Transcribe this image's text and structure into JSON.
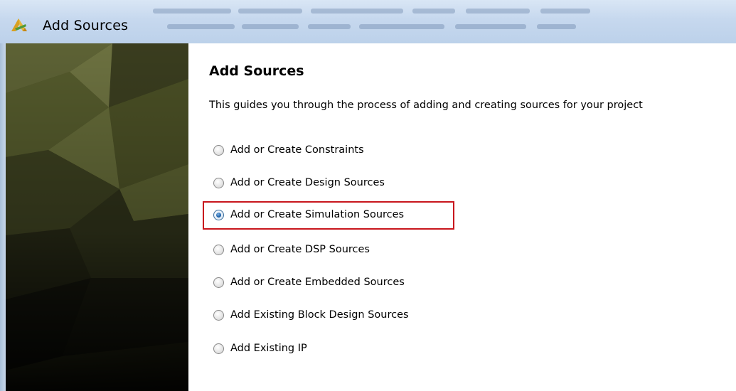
{
  "window": {
    "title": "Add Sources",
    "app_icon": "vivado-icon"
  },
  "page": {
    "heading": "Add Sources",
    "subtitle": "This guides you through the process of adding and creating sources for your project"
  },
  "options": [
    {
      "label": "Add or Create Constraints",
      "checked": false
    },
    {
      "label": "Add or Create Design Sources",
      "checked": false
    },
    {
      "label": "Add or Create Simulation Sources",
      "checked": true,
      "highlighted": true
    },
    {
      "label": "Add or Create DSP Sources",
      "checked": false
    },
    {
      "label": "Add or Create Embedded Sources",
      "checked": false
    },
    {
      "label": "Add Existing Block Design Sources",
      "checked": false
    },
    {
      "label": "Add Existing IP",
      "checked": false
    }
  ],
  "colors": {
    "highlight_border": "#c8161d",
    "radio_selected": "#1b5fa8"
  }
}
